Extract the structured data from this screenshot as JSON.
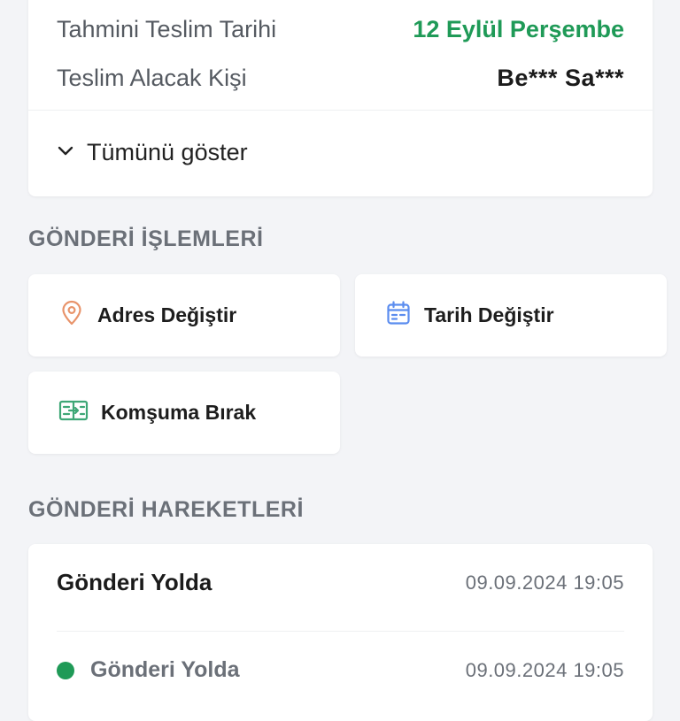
{
  "delivery_info": {
    "estimated_label": "Tahmini Teslim Tarihi",
    "estimated_value": "12 Eylül Perşembe",
    "recipient_label": "Teslim Alacak Kişi",
    "recipient_value": "Be*** Sa***",
    "show_all_label": "Tümünü göster"
  },
  "actions_section": {
    "title": "GÖNDERİ İŞLEMLERİ",
    "items": [
      {
        "label": "Adres Değiştir",
        "icon": "location-pin-icon",
        "color": "#e8936a"
      },
      {
        "label": "Tarih Değiştir",
        "icon": "calendar-icon",
        "color": "#5b8def"
      },
      {
        "label": "Komşuma Bırak",
        "icon": "neighbor-transfer-icon",
        "color": "#3ea776"
      }
    ]
  },
  "movements_section": {
    "title": "GÖNDERİ HAREKETLERİ",
    "header": {
      "title": "Gönderi Yolda",
      "datetime": "09.09.2024 19:05"
    },
    "events": [
      {
        "title": "Gönderi Yolda",
        "datetime": "09.09.2024 19:05",
        "status_color": "#1f9a57"
      }
    ]
  },
  "colors": {
    "background": "#f3f4f7",
    "accent_green": "#1f9a57",
    "muted_text": "#6b7078"
  }
}
